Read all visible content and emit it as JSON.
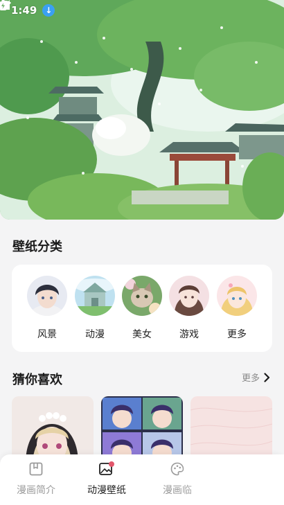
{
  "status_bar": {
    "time": "1:49",
    "download_icon": "download-arrow-icon",
    "wifi_icon": "wifi-icon",
    "signal_icon": "cell-signal-icon",
    "battery_icon": "battery-charging-icon"
  },
  "hero": {
    "image": "ancient-chinese-pavilion-green-trees-illustration"
  },
  "categories": {
    "title": "壁纸分类",
    "items": [
      {
        "label": "风景",
        "image": "anime-boy-portrait"
      },
      {
        "label": "动漫",
        "image": "castle-landscape"
      },
      {
        "label": "美女",
        "image": "cat-in-flowers"
      },
      {
        "label": "游戏",
        "image": "anime-girl-portrait"
      },
      {
        "label": "更多",
        "image": "blonde-princess-portrait"
      }
    ]
  },
  "recommend": {
    "title": "猜你喜欢",
    "more_label": "更多",
    "thumbs": [
      "anime-nun-girl",
      "anime-boys-grid",
      "pink-lace-texture"
    ]
  },
  "bottom_nav": {
    "items": [
      {
        "label": "漫画简介",
        "icon": "book-icon",
        "active": false
      },
      {
        "label": "动漫壁纸",
        "icon": "image-icon",
        "active": true
      },
      {
        "label": "漫画临",
        "icon": "palette-icon",
        "active": false
      }
    ]
  },
  "colors": {
    "accent": "#3aa0f3",
    "background": "#f4f4f5",
    "card": "#ffffff",
    "badge_dot": "#e2566b"
  }
}
